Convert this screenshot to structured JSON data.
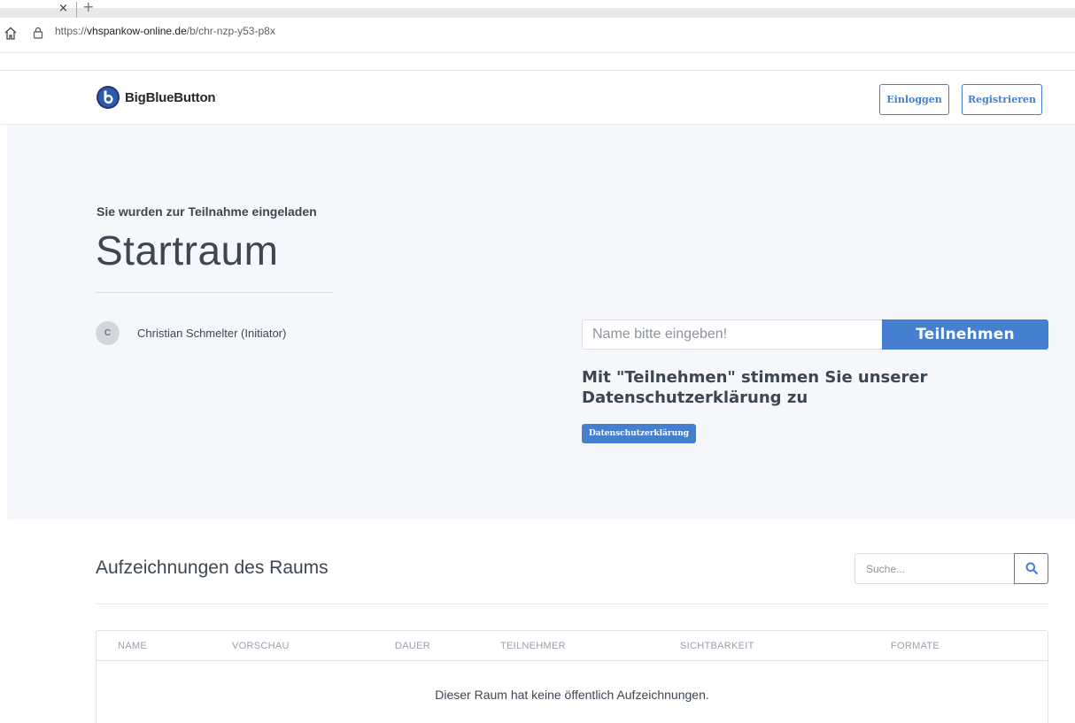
{
  "browser": {
    "tab_close": "×",
    "tab_new": "+",
    "url_scheme": "https://",
    "url_host": "vhspankow-online.de",
    "url_path": "/b/chr-nzp-y53-p8x"
  },
  "header": {
    "brand": "BigBlueButton",
    "brand_mark": "·",
    "login_label": "Einloggen",
    "register_label": "Registrieren"
  },
  "hero": {
    "invited_text": "Sie wurden zur Teilnahme eingeladen",
    "room_title": "Startraum",
    "owner_initial": "C",
    "owner_name": "Christian Schmelter (Initiator)",
    "name_placeholder": "Name bitte eingeben!",
    "join_label": "Teilnehmen",
    "consent_text": "Mit \"Teilnehmen\" stimmen Sie unserer Datenschutzerklärung zu",
    "privacy_label": "Datenschutzerklärung"
  },
  "recordings": {
    "title": "Aufzeichnungen des Raums",
    "search_placeholder": "Suche...",
    "columns": [
      "NAME",
      "VORSCHAU",
      "DAUER",
      "TEILNEHMER",
      "SICHTBARKEIT",
      "FORMATE"
    ],
    "empty_message": "Dieser Raum hat keine öffentlich Aufzeichnungen."
  },
  "colors": {
    "primary": "#467fcf",
    "hero_bg": "#f5f7fb",
    "text": "#3d4752"
  },
  "icons": {
    "home": "home-icon",
    "lock": "lock-icon",
    "logo": "bigbluebutton-logo-icon",
    "search": "search-icon"
  }
}
